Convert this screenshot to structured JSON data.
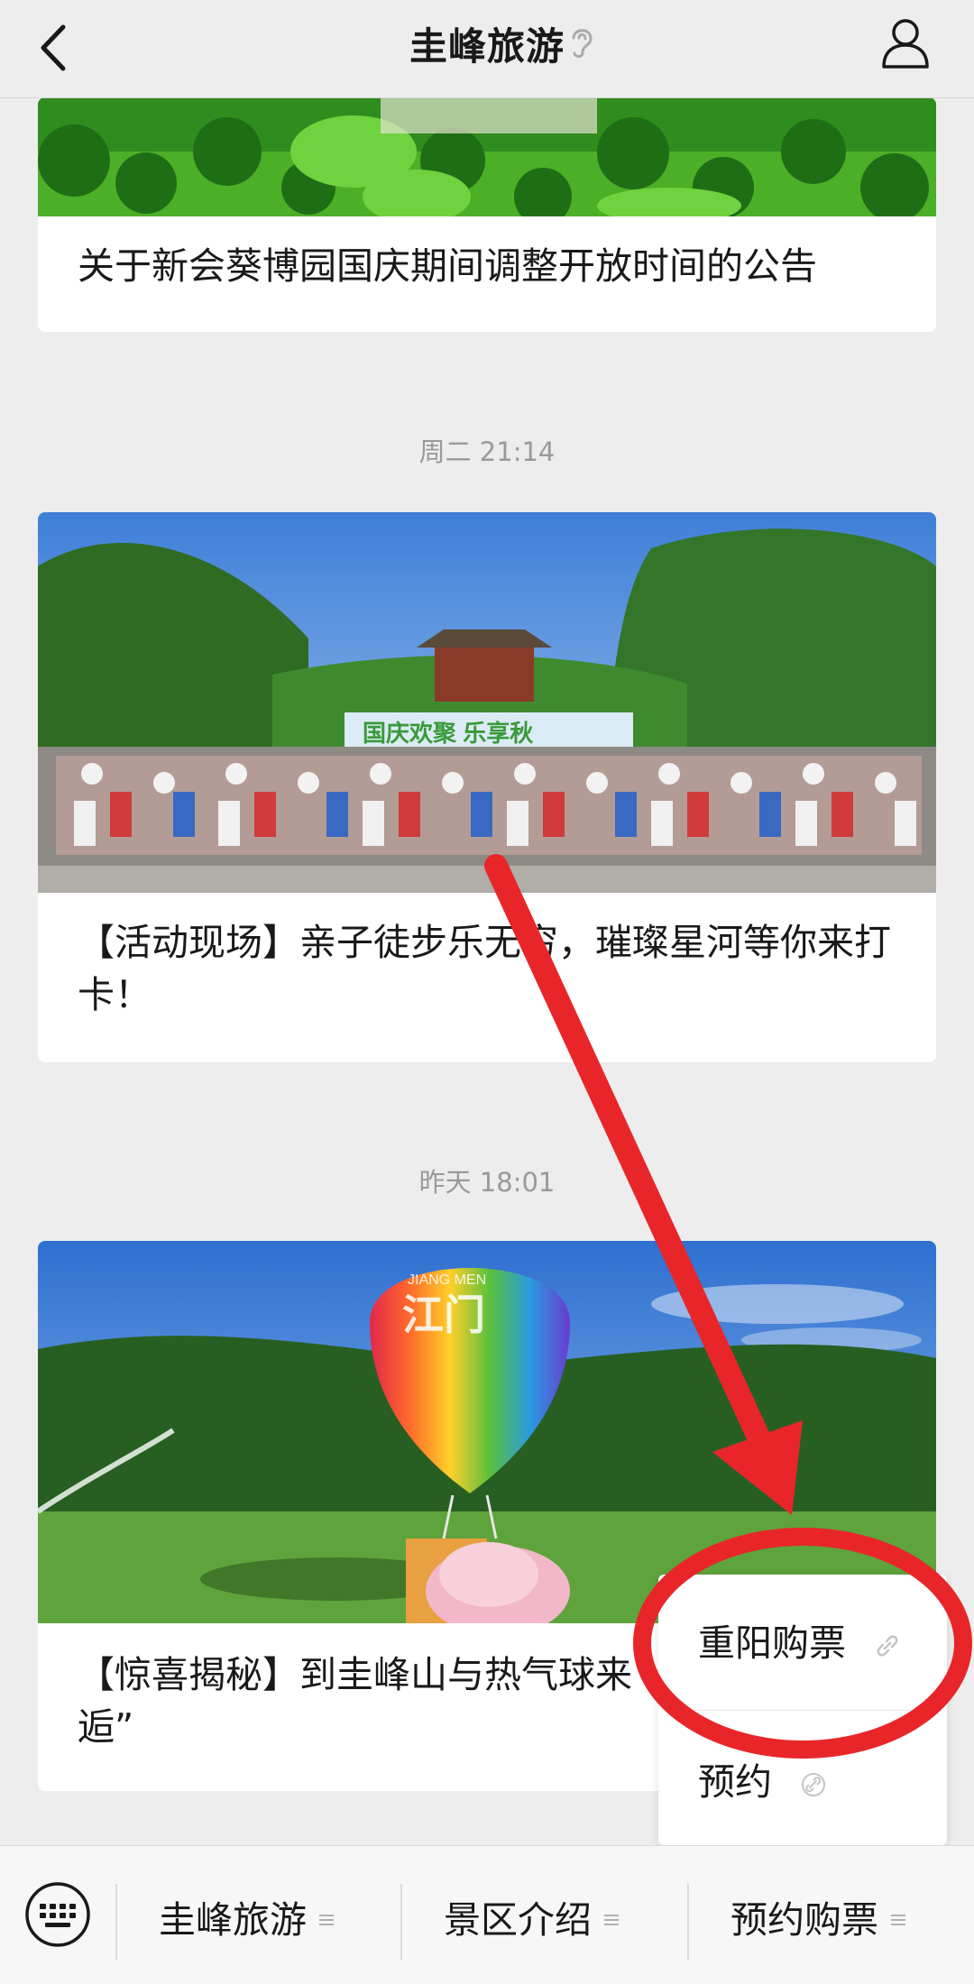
{
  "header": {
    "title": "圭峰旅游",
    "back_icon": "chevron-left-icon",
    "ear_icon": "ear-icon",
    "user_icon": "user-icon"
  },
  "messages": [
    {
      "title": "关于新会葵博园国庆期间调整开放时间的公告"
    },
    {
      "timestamp": "周二 21:14",
      "title": "【活动现场】亲子徒步乐无穷，璀璨星河等你来打卡！",
      "banner_text": "国庆欢聚  乐享秋"
    },
    {
      "timestamp": "昨天 18:01",
      "title": "【惊喜揭秘】到圭峰山与热气球来一场“邂逅”",
      "title_line2": "逅”",
      "balloon_text": "江门",
      "balloon_arc": "JIANG MEN"
    }
  ],
  "popup_menu": {
    "items": [
      {
        "label": "重阳购票",
        "icon": "link-icon"
      },
      {
        "label": "预约",
        "icon": "link-icon"
      }
    ]
  },
  "bottom_menu": {
    "keyboard_icon": "keyboard-icon",
    "items": [
      {
        "label": "圭峰旅游",
        "icon": "menu-lines-icon"
      },
      {
        "label": "景区介绍",
        "icon": "menu-lines-icon"
      },
      {
        "label": "预约购票",
        "icon": "menu-lines-icon"
      }
    ]
  },
  "annotation": {
    "color": "#e8262a",
    "shapes": "arrow-and-circle-highlight"
  }
}
